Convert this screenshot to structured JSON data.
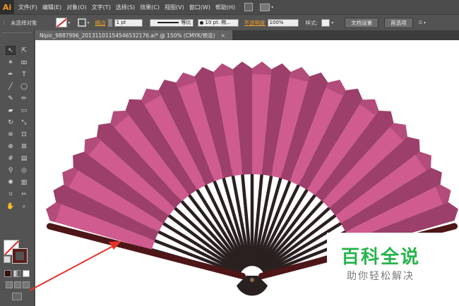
{
  "menubar": {
    "app_logo": "Ai",
    "items": [
      "文件(F)",
      "编辑(E)",
      "对象(O)",
      "文字(T)",
      "选择(S)",
      "效果(C)",
      "视图(V)",
      "窗口(W)",
      "帮助(H)"
    ]
  },
  "controlbar": {
    "selection_status": "未选择对象",
    "stroke_label": "描边",
    "stroke_weight": "1 pt",
    "stroke_profile": "等比",
    "brush_label": "10 pt. 椭...",
    "opacity_label": "不透明度",
    "opacity_value": "100%",
    "style_label": "样式:",
    "document_setup_button": "文档设置",
    "preferences_button": "首选项"
  },
  "document_tab": {
    "title": "Nipic_9887996_20131101154546532176.ai* @ 150% (CMYK/预览)",
    "close": "×"
  },
  "artwork": {
    "fan_colors": {
      "paper_light": "#cf5b8f",
      "paper_dark": "#9c3f6a",
      "border": "#4e1618",
      "ribs": "#2a2020"
    },
    "annotation_arrow_color": "#e5332a"
  },
  "watermark": {
    "title": "百科全说",
    "subtitle": "助你轻松解决",
    "color": "#27b44c"
  }
}
